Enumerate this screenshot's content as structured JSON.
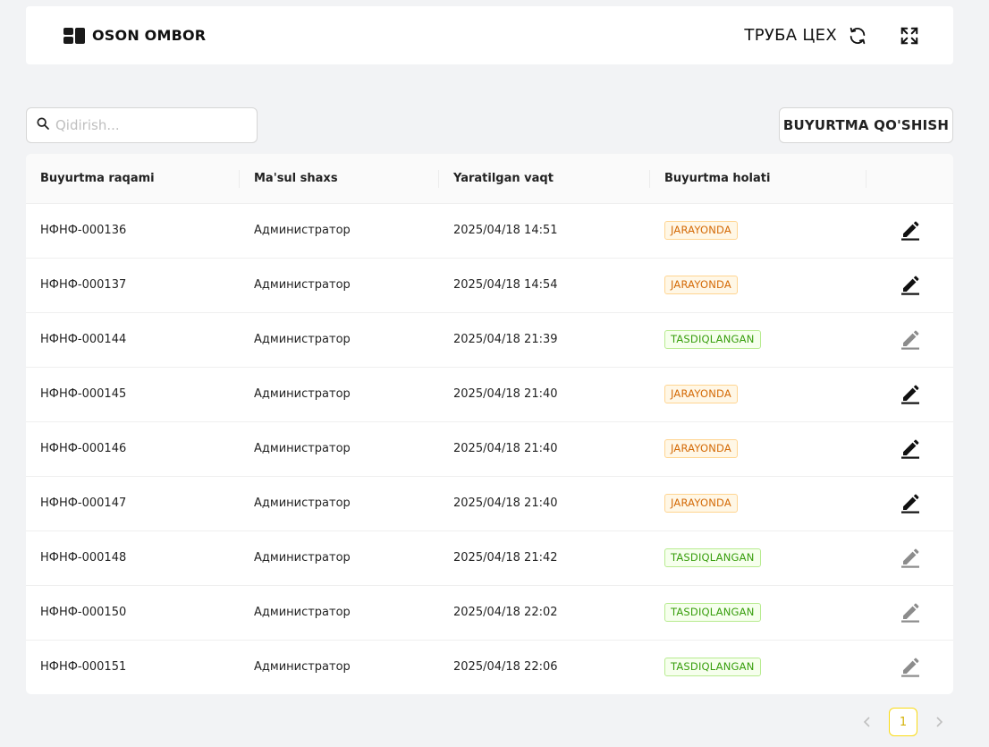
{
  "header": {
    "brand_name": "OSON OMBOR",
    "shop_name": "ТРУБА ЦЕХ"
  },
  "search": {
    "placeholder": "Qidirish..."
  },
  "toolbar": {
    "add_label": "BUYURTMA QO'SHISH"
  },
  "table": {
    "columns": [
      "Buyurtma raqami",
      "Ma'sul shaxs",
      "Yaratilgan vaqt",
      "Buyurtma holati",
      ""
    ],
    "rows": [
      {
        "number": "НФНФ-000136",
        "person": "Администратор",
        "created": "2025/04/18 14:51",
        "status": "JARAYONDA",
        "status_type": "progress"
      },
      {
        "number": "НФНФ-000137",
        "person": "Администратор",
        "created": "2025/04/18 14:54",
        "status": "JARAYONDA",
        "status_type": "progress"
      },
      {
        "number": "НФНФ-000144",
        "person": "Администратор",
        "created": "2025/04/18 21:39",
        "status": "TASDIQLANGAN",
        "status_type": "approved"
      },
      {
        "number": "НФНФ-000145",
        "person": "Администратор",
        "created": "2025/04/18 21:40",
        "status": "JARAYONDA",
        "status_type": "progress"
      },
      {
        "number": "НФНФ-000146",
        "person": "Администратор",
        "created": "2025/04/18 21:40",
        "status": "JARAYONDA",
        "status_type": "progress"
      },
      {
        "number": "НФНФ-000147",
        "person": "Администратор",
        "created": "2025/04/18 21:40",
        "status": "JARAYONDA",
        "status_type": "progress"
      },
      {
        "number": "НФНФ-000148",
        "person": "Администратор",
        "created": "2025/04/18 21:42",
        "status": "TASDIQLANGAN",
        "status_type": "approved"
      },
      {
        "number": "НФНФ-000150",
        "person": "Администратор",
        "created": "2025/04/18 22:02",
        "status": "TASDIQLANGAN",
        "status_type": "approved"
      },
      {
        "number": "НФНФ-000151",
        "person": "Администратор",
        "created": "2025/04/18 22:06",
        "status": "TASDIQLANGAN",
        "status_type": "approved"
      }
    ]
  },
  "pagination": {
    "current_page": "1",
    "prev_icon": "chevron-left-icon",
    "next_icon": "chevron-right-icon"
  },
  "colors": {
    "progress": "#d46b08",
    "approved": "#389e0d",
    "edit_active": "#111111",
    "edit_disabled": "#8c8c8c",
    "page_active": "#fadb14"
  }
}
